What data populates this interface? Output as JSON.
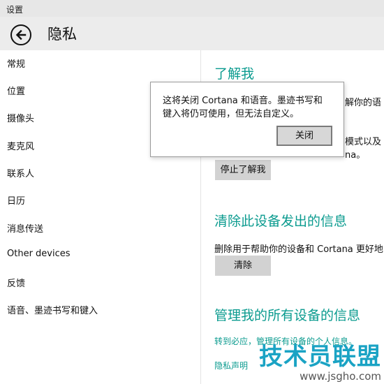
{
  "window": {
    "title": "设置"
  },
  "header": {
    "title": "隐私"
  },
  "sidebar": {
    "items": [
      {
        "label": "常规"
      },
      {
        "label": "位置"
      },
      {
        "label": "摄像头"
      },
      {
        "label": "麦克风"
      },
      {
        "label": "联系人"
      },
      {
        "label": "日历"
      },
      {
        "label": "消息传送"
      },
      {
        "label": "Other devices"
      },
      {
        "label": "反馈"
      },
      {
        "label": "语音、墨迹书写和键入"
      }
    ]
  },
  "main": {
    "know_me": {
      "title": "了解我",
      "peek_line1": "解你的语",
      "peek_line2": "模式以及",
      "peek_line3": "na。",
      "stop_button": "停止了解我"
    },
    "clear": {
      "title": "清除此设备发出的信息",
      "description": "删除用于帮助你的设备和 Cortana 更好地",
      "button": "清除"
    },
    "manage": {
      "title": "管理我的所有设备的信息",
      "link1": "转到必应，管理所有设备的个人信息。",
      "link2": "隐私声明"
    }
  },
  "dialog": {
    "line1": "这将关闭 Cortana 和语音。墨迹书写和",
    "line2": "键入将仍可使用，但无法自定义。",
    "close_button": "关闭"
  },
  "watermark": {
    "text": "技术员联盟",
    "url": "www.jsgho.com"
  }
}
